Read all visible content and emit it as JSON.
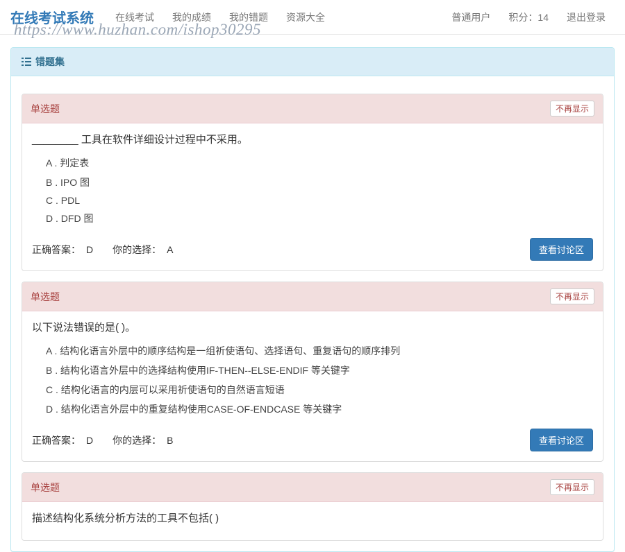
{
  "nav": {
    "brand": "在线考试系统",
    "left": [
      "在线考试",
      "我的成绩",
      "我的错题",
      "资源大全"
    ],
    "user_label": "普通用户",
    "points_label": "积分：",
    "points_value": "14",
    "logout": "退出登录"
  },
  "watermark": "https://www.huzhan.com/ishop30295",
  "panel": {
    "title": "错题集"
  },
  "labels": {
    "dismiss": "不再显示",
    "correct": "正确答案：",
    "your": "你的选择：",
    "discuss": "查看讨论区"
  },
  "questions": [
    {
      "type": "单选题",
      "stem": "________ 工具在软件详细设计过程中不采用。",
      "options": [
        "A . 判定表",
        "B . IPO 图",
        "C . PDL",
        "D . DFD 图"
      ],
      "correct": "D",
      "chosen": "A"
    },
    {
      "type": "单选题",
      "stem": "以下说法错误的是( )。",
      "options": [
        "A . 结构化语言外层中的顺序结构是一组祈使语句、选择语句、重复语句的顺序排列",
        "B . 结构化语言外层中的选择结构使用IF-THEN--ELSE-ENDIF 等关键字",
        "C . 结构化语言的内层可以采用祈使语句的自然语言短语",
        "D . 结构化语言外层中的重复结构使用CASE-OF-ENDCASE 等关键字"
      ],
      "correct": "D",
      "chosen": "B"
    },
    {
      "type": "单选题",
      "stem": "描述结构化系统分析方法的工具不包括( )",
      "options": [],
      "correct": "",
      "chosen": ""
    }
  ]
}
